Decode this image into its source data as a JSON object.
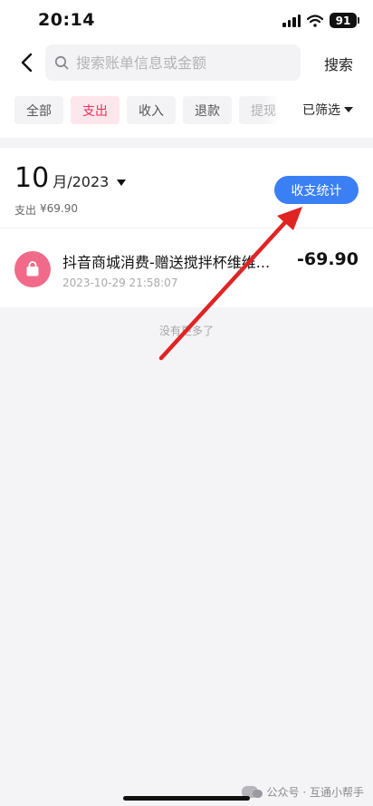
{
  "status_bar": {
    "time": "20:14",
    "battery": "91"
  },
  "search": {
    "placeholder": "搜索账单信息或金额",
    "button": "搜索"
  },
  "filters": {
    "chips": [
      "全部",
      "支出",
      "收入",
      "退款",
      "提现"
    ],
    "active": "支出",
    "filtered_label": "已筛选"
  },
  "month": {
    "number": "10",
    "suffix": "月/2023",
    "spend_label": "支出",
    "spend_amount": "¥69.90",
    "stats_button": "收支统计"
  },
  "transaction": {
    "title": "抖音商城消费-赠送搅拌杯维维...",
    "time": "2023-10-29 21:58:07",
    "amount": "-69.90"
  },
  "list_end": "没有更多了",
  "watermark": "公众号 · 互通小帮手",
  "colors": {
    "accent_blue": "#3b7ff5",
    "active_red": "#e8315c",
    "icon_pink": "#f16a8a",
    "arrow_red": "#e02424"
  }
}
